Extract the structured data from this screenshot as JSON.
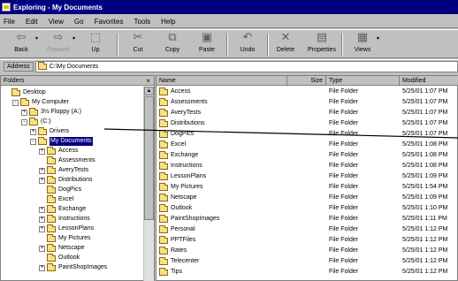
{
  "window": {
    "title": "Exploring - My Documents"
  },
  "menu": [
    "File",
    "Edit",
    "View",
    "Go",
    "Favorites",
    "Tools",
    "Help"
  ],
  "toolbar": {
    "back": "Back",
    "forward": "Forward",
    "up": "Up",
    "cut": "Cut",
    "copy": "Copy",
    "paste": "Paste",
    "undo": "Undo",
    "delete": "Delete",
    "properties": "Properties",
    "views": "Views"
  },
  "address": {
    "label": "Address",
    "value": "C:\\My Documents"
  },
  "folders_pane": {
    "title": "Folders",
    "close": "×",
    "tree": [
      {
        "label": "Desktop",
        "level": 0,
        "pm": ""
      },
      {
        "label": "My Computer",
        "level": 1,
        "pm": "-"
      },
      {
        "label": "3½ Floppy (A:)",
        "level": 2,
        "pm": "+"
      },
      {
        "label": "(C:)",
        "level": 2,
        "pm": "-"
      },
      {
        "label": "Drivers",
        "level": 3,
        "pm": "+"
      },
      {
        "label": "My Documents",
        "level": 3,
        "pm": "-",
        "selected": true
      },
      {
        "label": "Access",
        "level": 4,
        "pm": "+"
      },
      {
        "label": "Assessments",
        "level": 4,
        "pm": ""
      },
      {
        "label": "AveryTests",
        "level": 4,
        "pm": "+"
      },
      {
        "label": "Distributions",
        "level": 4,
        "pm": "+"
      },
      {
        "label": "DogPics",
        "level": 4,
        "pm": ""
      },
      {
        "label": "Excel",
        "level": 4,
        "pm": ""
      },
      {
        "label": "Exchange",
        "level": 4,
        "pm": "+"
      },
      {
        "label": "Instructions",
        "level": 4,
        "pm": "+"
      },
      {
        "label": "LessonPlans",
        "level": 4,
        "pm": "+"
      },
      {
        "label": "My Pictures",
        "level": 4,
        "pm": ""
      },
      {
        "label": "Netscape",
        "level": 4,
        "pm": "+"
      },
      {
        "label": "Outlook",
        "level": 4,
        "pm": ""
      },
      {
        "label": "PaintShopImages",
        "level": 4,
        "pm": "+"
      }
    ]
  },
  "files_pane": {
    "columns": {
      "name": "Name",
      "size": "Size",
      "type": "Type",
      "modified": "Modified"
    },
    "rows": [
      {
        "name": "Access",
        "type": "File Folder",
        "modified": "5/25/01 1:07 PM"
      },
      {
        "name": "Assessments",
        "type": "File Folder",
        "modified": "5/25/01 1:07 PM"
      },
      {
        "name": "AveryTests",
        "type": "File Folder",
        "modified": "5/25/01 1:07 PM"
      },
      {
        "name": "Distributions",
        "type": "File Folder",
        "modified": "5/25/01 1:07 PM"
      },
      {
        "name": "DogPics",
        "type": "File Folder",
        "modified": "5/25/01 1:07 PM"
      },
      {
        "name": "Excel",
        "type": "File Folder",
        "modified": "5/25/01 1:08 PM"
      },
      {
        "name": "Exchange",
        "type": "File Folder",
        "modified": "5/25/01 1:08 PM"
      },
      {
        "name": "Instructions",
        "type": "File Folder",
        "modified": "5/25/01 1:08 PM"
      },
      {
        "name": "LessonPlans",
        "type": "File Folder",
        "modified": "5/25/01 1:09 PM"
      },
      {
        "name": "My Pictures",
        "type": "File Folder",
        "modified": "5/25/01 1:54 PM"
      },
      {
        "name": "Netscape",
        "type": "File Folder",
        "modified": "5/25/01 1:09 PM"
      },
      {
        "name": "Outlook",
        "type": "File Folder",
        "modified": "5/25/01 1:10 PM"
      },
      {
        "name": "PaintShopImages",
        "type": "File Folder",
        "modified": "5/25/01 1:11 PM"
      },
      {
        "name": "Personal",
        "type": "File Folder",
        "modified": "5/25/01 1:12 PM"
      },
      {
        "name": "PPTFiles",
        "type": "File Folder",
        "modified": "5/25/01 1:12 PM"
      },
      {
        "name": "Rates",
        "type": "File Folder",
        "modified": "5/25/01 1:12 PM"
      },
      {
        "name": "Telecenter",
        "type": "File Folder",
        "modified": "5/25/01 1:12 PM"
      },
      {
        "name": "Tips",
        "type": "File Folder",
        "modified": "5/25/01 1:12 PM"
      }
    ]
  },
  "colors": {
    "titlebar": "#000080",
    "selection": "#000080",
    "folder": "#f8e08a",
    "chrome": "#c0c0c0"
  }
}
